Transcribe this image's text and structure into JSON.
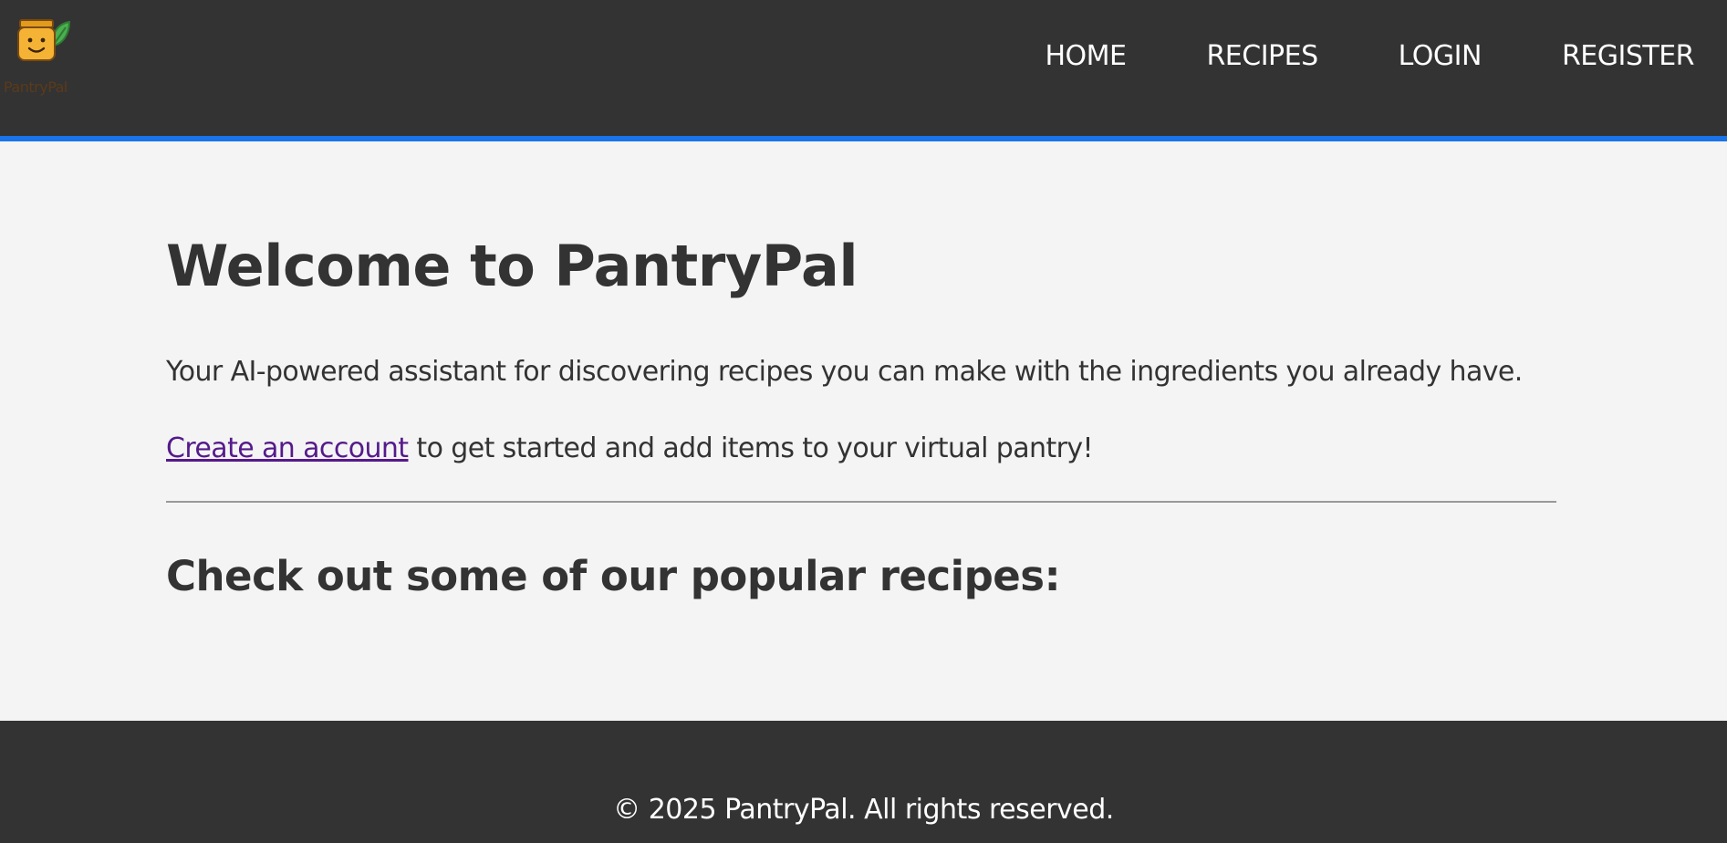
{
  "brand": {
    "name": "PantryPal",
    "logo_icon": "smiling-jar-with-leaf-icon"
  },
  "nav": {
    "items": [
      "HOME",
      "RECIPES",
      "LOGIN",
      "REGISTER"
    ]
  },
  "main": {
    "title": "Welcome to PantryPal",
    "intro": "Your AI-powered assistant for discovering recipes you can make with the ingredients you already have.",
    "cta_link": "Create an account",
    "cta_rest": " to get started and add items to your virtual pantry!",
    "popular_heading": "Check out some of our popular recipes:"
  },
  "footer": {
    "copyright": "© 2025 PantryPal. All rights reserved."
  },
  "colors": {
    "header_bg": "#333333",
    "accent": "#1a73e8",
    "page_bg": "#f4f4f4",
    "link_visited": "#551a8b",
    "logo_jar": "#f5b335",
    "logo_leaf": "#4caf50"
  }
}
